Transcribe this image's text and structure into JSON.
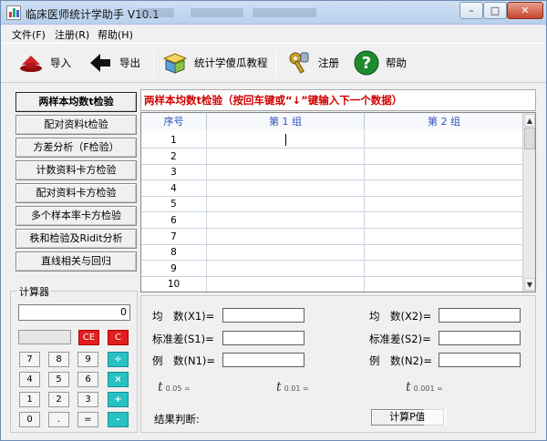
{
  "window": {
    "title": "临床医师统计学助手 V10.1",
    "controls": [
      "–",
      "□",
      "✕"
    ]
  },
  "menubar": {
    "items": [
      "文件(F)",
      "注册(R)",
      "帮助(H)"
    ]
  },
  "toolbar": {
    "import_label": "导入",
    "export_label": "导出",
    "tutorial_label": "统计学傻瓜教程",
    "register_label": "注册",
    "help_label": "帮助"
  },
  "sidebar": {
    "items": [
      {
        "label": "两样本均数t检验",
        "active": true
      },
      {
        "label": "配对资料t检验",
        "active": false
      },
      {
        "label": "方差分析（F检验）",
        "active": false
      },
      {
        "label": "计数资料卡方检验",
        "active": false
      },
      {
        "label": "配对资料卡方检验",
        "active": false
      },
      {
        "label": "多个样本率卡方检验",
        "active": false
      },
      {
        "label": "秩和检验及Ridit分析",
        "active": false
      },
      {
        "label": "直线相关与回归",
        "active": false
      }
    ]
  },
  "calculator": {
    "title": "计算器",
    "display": "0",
    "clear_entry": "CE",
    "clear": "C",
    "keys": [
      [
        "7",
        "8",
        "9",
        "÷"
      ],
      [
        "4",
        "5",
        "6",
        "×"
      ],
      [
        "1",
        "2",
        "3",
        "+"
      ],
      [
        "0",
        ".",
        "=",
        "-"
      ]
    ]
  },
  "main": {
    "instruction": "两样本均数t检验（按回车键或“↓”键输入下一个数据）",
    "grid": {
      "headers": [
        "序号",
        "第 1 组",
        "第 2 组"
      ],
      "rows": [
        "1",
        "2",
        "3",
        "4",
        "5",
        "6",
        "7",
        "8",
        "9",
        "10"
      ]
    }
  },
  "result": {
    "mean1_label": "均　数(X1)=",
    "mean2_label": "均　数(X2)=",
    "sd1_label": "标准差(S1)=",
    "sd2_label": "标准差(S2)=",
    "n1_label": "例　数(N1)=",
    "n2_label": "例　数(N2)=",
    "t_symbol": "t",
    "t005_sub": "0.05 =",
    "t001_sub": "0.01 =",
    "t0001_sub": "0.001 =",
    "conclusion_label": "结果判断:",
    "calculate_label": "计算P值"
  }
}
